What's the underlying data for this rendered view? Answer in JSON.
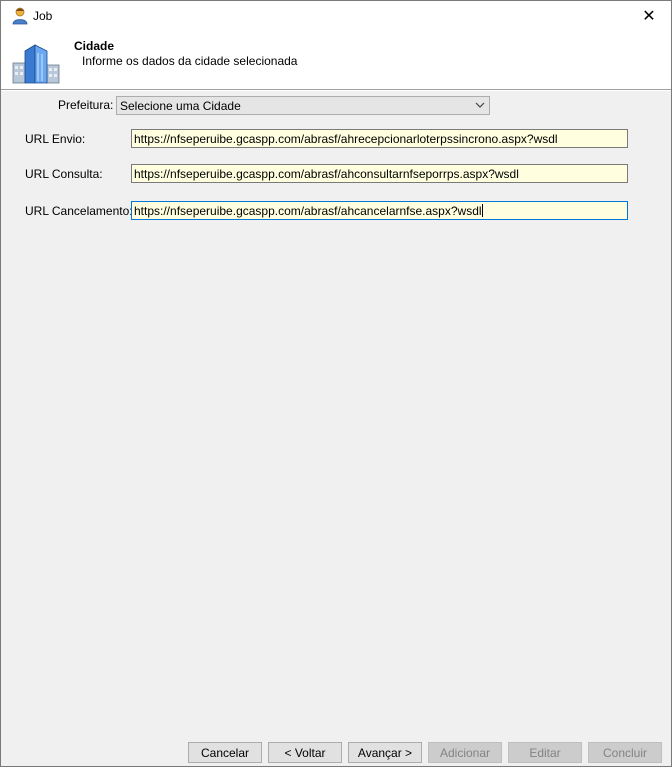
{
  "window": {
    "title": "Job",
    "close_glyph": "✕"
  },
  "header": {
    "title": "Cidade",
    "subtitle": "Informe os dados da cidade selecionada",
    "icon": "buildings-icon"
  },
  "form": {
    "prefeitura": {
      "label": "Prefeitura:",
      "value": "Selecione uma Cidade"
    },
    "url_envio": {
      "label": "URL Envio:",
      "value": "https://nfseperuibe.gcaspp.com/abrasf/ahrecepcionarloterpssincrono.aspx?wsdl"
    },
    "url_consulta": {
      "label": "URL Consulta:",
      "value": "https://nfseperuibe.gcaspp.com/abrasf/ahconsultarnfseporrps.aspx?wsdl"
    },
    "url_cancelamento": {
      "label": "URL Cancelamento:",
      "value": "https://nfseperuibe.gcaspp.com/abrasf/ahcancelarnfse.aspx?wsdl"
    }
  },
  "buttons": {
    "cancelar": "Cancelar",
    "voltar": "< Voltar",
    "avancar": "Avançar >",
    "adicionar": "Adicionar",
    "editar": "Editar",
    "concluir": "Concluir"
  },
  "colors": {
    "textbox_bg": "#ffffe0",
    "focus_border": "#0078d7"
  }
}
